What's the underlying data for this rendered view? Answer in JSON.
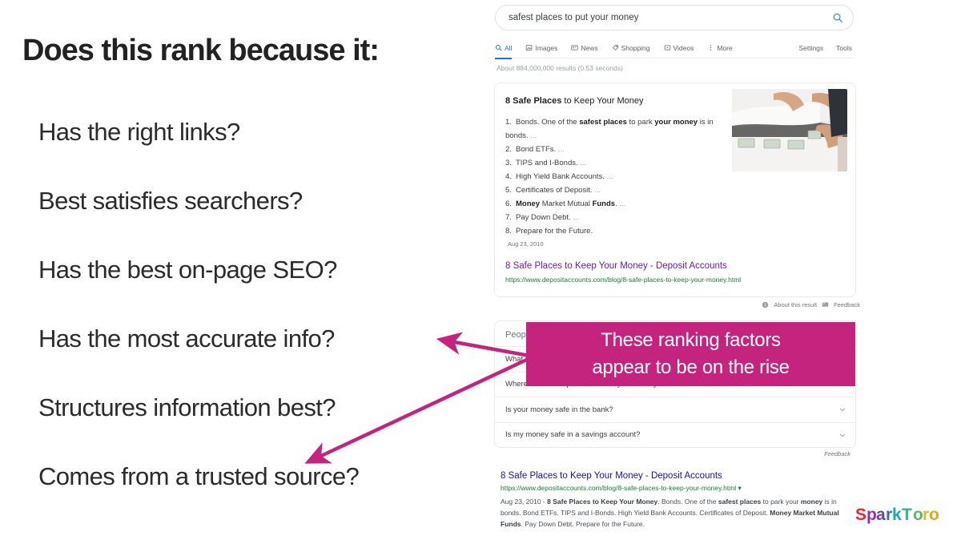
{
  "slide": {
    "headline": "Does this rank because it:",
    "factors": [
      "Has the right links?",
      "Best satisfies searchers?",
      "Has the best on-page SEO?",
      "Has the most accurate info?",
      "Structures information best?",
      "Comes from a trusted source?"
    ],
    "callout": {
      "line1": "These ranking factors",
      "line2": "appear to be on the rise",
      "background_color": "#c4247e",
      "text_color": "#ffffff"
    },
    "arrow_color": "#c4247e",
    "logo": {
      "text": "SparkToro",
      "letters": [
        {
          "ch": "S",
          "color": "#e8262c"
        },
        {
          "ch": "p",
          "color": "#9b2fa0"
        },
        {
          "ch": "a",
          "color": "#6f3fa8"
        },
        {
          "ch": "r",
          "color": "#2f6fc0"
        },
        {
          "ch": "k",
          "color": "#1aa3c8"
        },
        {
          "ch": "T",
          "color": "#2fb39a"
        },
        {
          "ch": "o",
          "color": "#5cb85c"
        },
        {
          "ch": "r",
          "color": "#c8c334"
        },
        {
          "ch": "o",
          "color": "#f2a10c"
        }
      ]
    }
  },
  "serp": {
    "search": {
      "query": "safest places to put your money",
      "placeholder": "Search",
      "icon": "search-icon"
    },
    "nav": {
      "tabs": [
        {
          "label": "All",
          "icon": "search-icon",
          "active": true
        },
        {
          "label": "Images",
          "icon": "image-icon",
          "active": false
        },
        {
          "label": "News",
          "icon": "news-icon",
          "active": false
        },
        {
          "label": "Shopping",
          "icon": "tag-icon",
          "active": false
        },
        {
          "label": "Videos",
          "icon": "video-icon",
          "active": false
        },
        {
          "label": "More",
          "icon": "more-vertical-icon",
          "active": false
        }
      ],
      "right": [
        "Settings",
        "Tools"
      ]
    },
    "results_count": "About 884,000,000 results (0.53 seconds)",
    "featured_snippet": {
      "title_prefix": "8 Safe Places",
      "title_rest": " to Keep Your Money",
      "items": [
        {
          "n": "1.",
          "html": "Bonds. One of the <b>safest places</b> to park <b>your money</b> is in bonds. <span class=\"faint\">...</span>",
          "wrap": true
        },
        {
          "n": "2.",
          "html": "Bond ETFs. <span class=\"faint\">...</span>",
          "wrap": false
        },
        {
          "n": "3.",
          "html": "TIPS and I-Bonds. <span class=\"faint\">...</span>",
          "wrap": false
        },
        {
          "n": "4.",
          "html": "High Yield Bank Accounts. <span class=\"faint\">...</span>",
          "wrap": false
        },
        {
          "n": "5.",
          "html": "Certificates of Deposit. <span class=\"faint\">...</span>",
          "wrap": false
        },
        {
          "n": "6.",
          "html": "<b>Money</b> Market Mutual <b>Funds</b>. <span class=\"faint\">...</span>",
          "wrap": false
        },
        {
          "n": "7.",
          "html": "Pay Down Debt. <span class=\"faint\">...</span>",
          "wrap": false
        },
        {
          "n": "8.",
          "html": "Prepare for the Future.",
          "wrap": false
        }
      ],
      "date": "Aug 23, 2010",
      "link_title": "8 Safe Places to Keep Your Money - Deposit Accounts",
      "url": "https://www.depositaccounts.com/blog/8-safe-places-to-keep-your-money.html",
      "about_label": "About this result",
      "feedback_label": "Feedback",
      "thumbnail_alt": "hands placing cash under a mattress"
    },
    "people_also_ask": {
      "header": "People also ask",
      "questions": [
        "What is the safest place to keep your money?",
        "Where is the best place to invest your money?",
        "Is your money safe in the bank?",
        "Is my money safe in a savings account?"
      ],
      "feedback_label": "Feedback"
    },
    "organic_result": {
      "title": "8 Safe Places to Keep Your Money - Deposit Accounts",
      "url": "https://www.depositaccounts.com/blog/8-safe-places-to-keep-your-money.html",
      "desc_date": "Aug 23, 2010 - ",
      "desc_html": "<b>8 Safe Places to Keep Your Money</b>. Bonds. One of the <b>safest places</b> to park your <b>money</b> is in bonds. Bond ETFs. TIPS and I-Bonds. High Yield Bank Accounts. Certificates of Deposit. <b>Money Market Mutual Funds</b>. Pay Down Debt. Prepare for the Future."
    }
  }
}
